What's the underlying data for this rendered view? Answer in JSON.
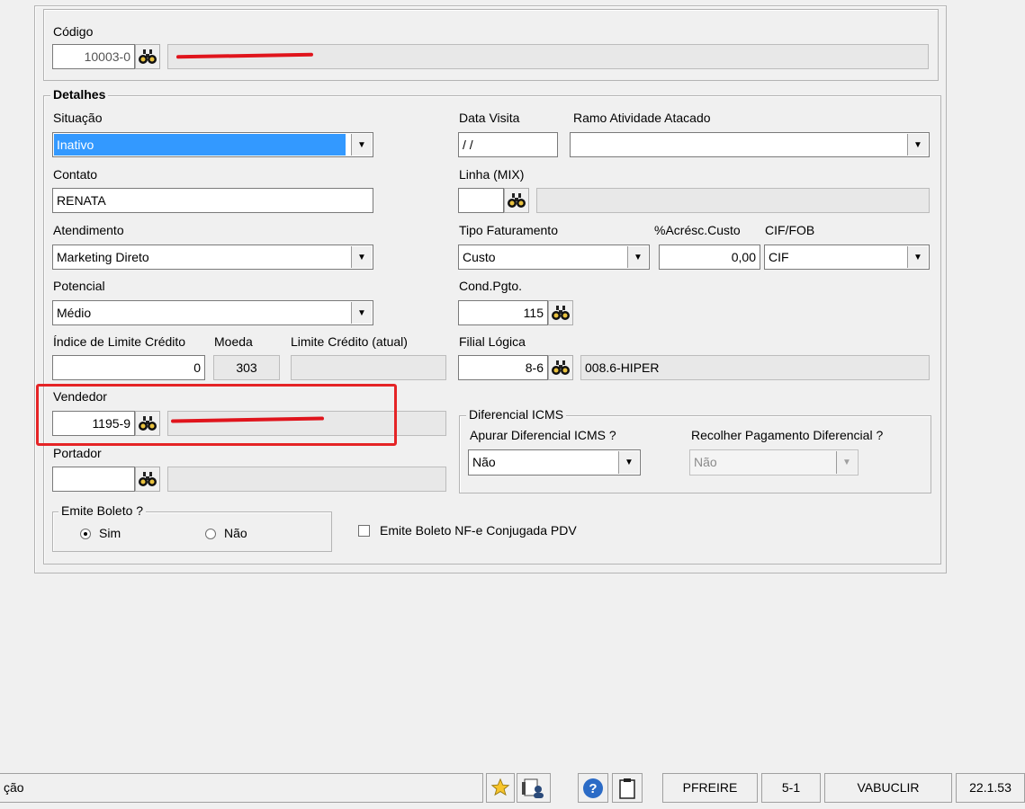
{
  "codigo": {
    "label": "Código",
    "value": "10003-0"
  },
  "detalhes": {
    "legend": "Detalhes",
    "situacao": {
      "label": "Situação",
      "value": "Inativo"
    },
    "data_visita": {
      "label": "Data Visita",
      "value": " / /"
    },
    "ramo_atividade": {
      "label": "Ramo Atividade Atacado",
      "value": ""
    },
    "contato": {
      "label": "Contato",
      "value": "RENATA"
    },
    "linha_mix": {
      "label": "Linha (MIX)",
      "value": ""
    },
    "atendimento": {
      "label": "Atendimento",
      "value": "Marketing Direto"
    },
    "tipo_faturamento": {
      "label": "Tipo Faturamento",
      "value": "Custo"
    },
    "acresc_custo": {
      "label": "%Acrésc.Custo",
      "value": "0,00"
    },
    "cif_fob": {
      "label": "CIF/FOB",
      "value": "CIF"
    },
    "potencial": {
      "label": "Potencial",
      "value": "Médio"
    },
    "cond_pgto": {
      "label": "Cond.Pgto.",
      "value": "115"
    },
    "indice_limite": {
      "label": "Índice de Limite Crédito",
      "value": "0"
    },
    "moeda": {
      "label": "Moeda",
      "value": "303"
    },
    "limite_credito": {
      "label": "Limite Crédito (atual)",
      "value": ""
    },
    "filial_logica": {
      "label": "Filial Lógica",
      "value": "8-6",
      "desc": "008.6-HIPER"
    },
    "vendedor": {
      "label": "Vendedor",
      "value": "1195-9"
    },
    "portador": {
      "label": "Portador",
      "value": ""
    },
    "diferencial_icms": {
      "legend": "Diferencial ICMS",
      "apurar_label": "Apurar Diferencial ICMS ?",
      "apurar_value": "Não",
      "recolher_label": "Recolher Pagamento Diferencial ?",
      "recolher_value": "Não"
    },
    "emite_boleto": {
      "legend": "Emite Boleto ?",
      "sim": "Sim",
      "nao": "Não",
      "selected": "Sim"
    },
    "emite_boleto_nfe": {
      "label": "Emite Boleto NF-e Conjugada PDV",
      "checked": false
    }
  },
  "statusbar": {
    "left_text": "ção",
    "user": "PFREIRE",
    "code": "5-1",
    "host": "VABUCLIR",
    "version": "22.1.53"
  },
  "colors": {
    "highlight": "#e52426",
    "selection": "#3399ff",
    "redaction": "#e0141c"
  }
}
